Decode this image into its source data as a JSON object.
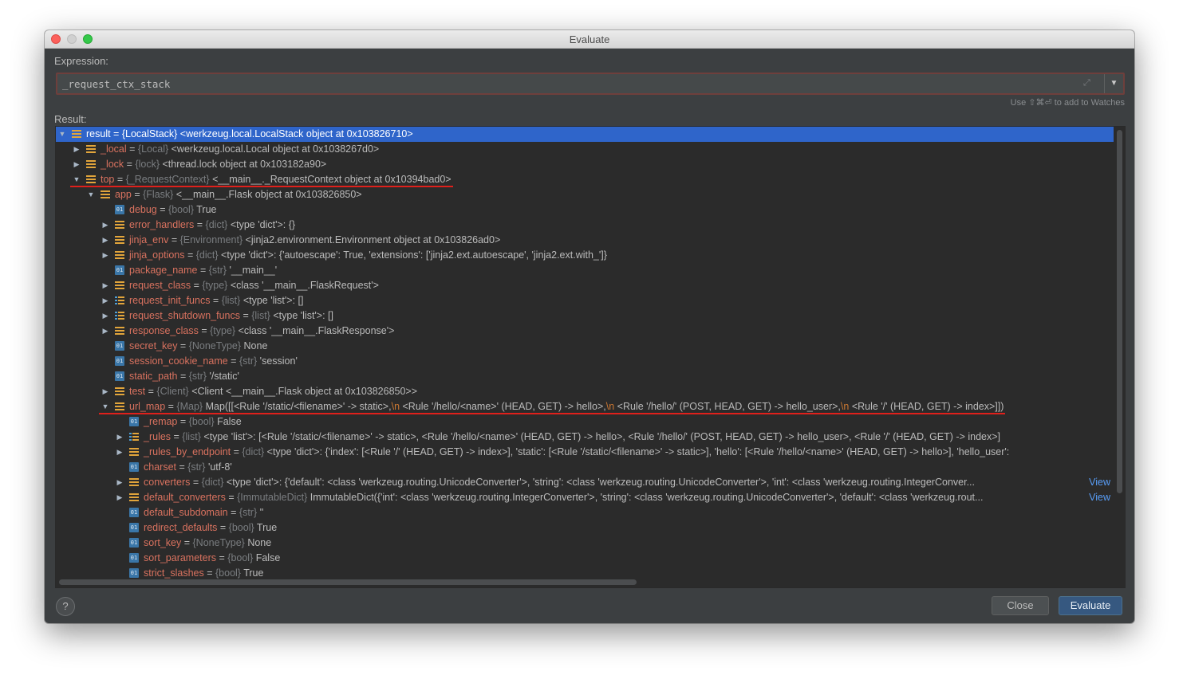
{
  "window": {
    "title": "Evaluate"
  },
  "expression": {
    "label": "Expression:",
    "value": "_request_ctx_stack",
    "hint": "Use ⇧⌘⏎ to add to Watches"
  },
  "result": {
    "label": "Result:"
  },
  "tree_rows": [
    {
      "name": "result",
      "type": "{LocalStack}",
      "value": "<werkzeug.local.LocalStack object at 0x103826710>",
      "toggle": "open",
      "icon": "obj",
      "level": 0,
      "selected": true
    },
    {
      "name": "_local",
      "type": "{Local}",
      "value": "<werkzeug.local.Local object at 0x1038267d0>",
      "toggle": "closed",
      "icon": "obj",
      "level": 1
    },
    {
      "name": "_lock",
      "type": "{lock}",
      "value": "<thread.lock object at 0x103182a90>",
      "toggle": "closed",
      "icon": "obj",
      "level": 1
    },
    {
      "name": "top",
      "type": "{_RequestContext}",
      "value": "<__main__._RequestContext object at 0x10394bad0>",
      "toggle": "open",
      "icon": "obj",
      "level": 1,
      "underline": true
    },
    {
      "name": "app",
      "type": "{Flask}",
      "value": "<__main__.Flask object at 0x103826850>",
      "toggle": "open",
      "icon": "obj",
      "level": 2
    },
    {
      "name": "debug",
      "type": "{bool}",
      "value": "True",
      "toggle": "none",
      "icon": "prim",
      "level": 3
    },
    {
      "name": "error_handlers",
      "type": "{dict}",
      "value": "<type 'dict'>: {}",
      "toggle": "closed",
      "icon": "obj",
      "level": 3
    },
    {
      "name": "jinja_env",
      "type": "{Environment}",
      "value": "<jinja2.environment.Environment object at 0x103826ad0>",
      "toggle": "closed",
      "icon": "obj",
      "level": 3
    },
    {
      "name": "jinja_options",
      "type": "{dict}",
      "value": "<type 'dict'>: {'autoescape': True, 'extensions': ['jinja2.ext.autoescape', 'jinja2.ext.with_']}",
      "toggle": "closed",
      "icon": "obj",
      "level": 3
    },
    {
      "name": "package_name",
      "type": "{str}",
      "value": "'__main__'",
      "toggle": "none",
      "icon": "prim",
      "level": 3
    },
    {
      "name": "request_class",
      "type": "{type}",
      "value": "<class '__main__.FlaskRequest'>",
      "toggle": "closed",
      "icon": "obj",
      "level": 3
    },
    {
      "name": "request_init_funcs",
      "type": "{list}",
      "value": "<type 'list'>: []",
      "toggle": "closed",
      "icon": "list",
      "level": 3
    },
    {
      "name": "request_shutdown_funcs",
      "type": "{list}",
      "value": "<type 'list'>: []",
      "toggle": "closed",
      "icon": "list",
      "level": 3
    },
    {
      "name": "response_class",
      "type": "{type}",
      "value": "<class '__main__.FlaskResponse'>",
      "toggle": "closed",
      "icon": "obj",
      "level": 3
    },
    {
      "name": "secret_key",
      "type": "{NoneType}",
      "value": "None",
      "toggle": "none",
      "icon": "prim",
      "level": 3
    },
    {
      "name": "session_cookie_name",
      "type": "{str}",
      "value": "'session'",
      "toggle": "none",
      "icon": "prim",
      "level": 3
    },
    {
      "name": "static_path",
      "type": "{str}",
      "value": "'/static'",
      "toggle": "none",
      "icon": "prim",
      "level": 3
    },
    {
      "name": "test",
      "type": "{Client}",
      "value": "<Client <__main__.Flask object at 0x103826850>>",
      "toggle": "closed",
      "icon": "obj",
      "level": 3
    },
    {
      "name": "url_map",
      "type": "{Map}",
      "value_parts": [
        "Map([[<Rule '/static/<filename>' -> static>,",
        "\\n",
        " <Rule '/hello/<name>' (HEAD, GET) -> hello>,",
        "\\n",
        " <Rule '/hello/' (POST, HEAD, GET) -> hello_user>,",
        "\\n",
        " <Rule '/' (HEAD, GET) -> index>]])"
      ],
      "toggle": "open",
      "icon": "obj",
      "level": 3,
      "underline": true
    },
    {
      "name": "_remap",
      "type": "{bool}",
      "value": "False",
      "toggle": "none",
      "icon": "prim",
      "level": 4
    },
    {
      "name": "_rules",
      "type": "{list}",
      "value": "<type 'list'>: [<Rule '/static/<filename>' -> static>, <Rule '/hello/<name>' (HEAD, GET) -> hello>, <Rule '/hello/' (POST, HEAD, GET) -> hello_user>, <Rule '/' (HEAD, GET) -> index>]",
      "toggle": "closed",
      "icon": "list",
      "level": 4
    },
    {
      "name": "_rules_by_endpoint",
      "type": "{dict}",
      "value": "<type 'dict'>: {'index': [<Rule '/' (HEAD, GET) -> index>], 'static': [<Rule '/static/<filename>' -> static>], 'hello': [<Rule '/hello/<name>' (HEAD, GET) -> hello>], 'hello_user':",
      "toggle": "closed",
      "icon": "obj",
      "level": 4
    },
    {
      "name": "charset",
      "type": "{str}",
      "value": "'utf-8'",
      "toggle": "none",
      "icon": "prim",
      "level": 4
    },
    {
      "name": "converters",
      "type": "{dict}",
      "value": "<type 'dict'>: {'default': <class 'werkzeug.routing.UnicodeConverter'>, 'string': <class 'werkzeug.routing.UnicodeConverter'>, 'int': <class 'werkzeug.routing.IntegerConver...",
      "toggle": "closed",
      "icon": "obj",
      "level": 4,
      "view": "View"
    },
    {
      "name": "default_converters",
      "type": "{ImmutableDict}",
      "value": "ImmutableDict({'int': <class 'werkzeug.routing.IntegerConverter'>, 'string': <class 'werkzeug.routing.UnicodeConverter'>, 'default': <class 'werkzeug.rout...",
      "toggle": "closed",
      "icon": "obj",
      "level": 4,
      "view": "View"
    },
    {
      "name": "default_subdomain",
      "type": "{str}",
      "value": "''",
      "toggle": "none",
      "icon": "prim",
      "level": 4
    },
    {
      "name": "redirect_defaults",
      "type": "{bool}",
      "value": "True",
      "toggle": "none",
      "icon": "prim",
      "level": 4
    },
    {
      "name": "sort_key",
      "type": "{NoneType}",
      "value": "None",
      "toggle": "none",
      "icon": "prim",
      "level": 4
    },
    {
      "name": "sort_parameters",
      "type": "{bool}",
      "value": "False",
      "toggle": "none",
      "icon": "prim",
      "level": 4
    },
    {
      "name": "strict_slashes",
      "type": "{bool}",
      "value": "True",
      "toggle": "none",
      "icon": "prim",
      "level": 4
    }
  ],
  "icons": {
    "prim_glyph": "01"
  },
  "buttons": {
    "help": "?",
    "close": "Close",
    "evaluate": "Evaluate"
  },
  "colors": {
    "window_bg": "#3c3f41",
    "tree_bg": "#2b2b2b",
    "selection": "#2f65ca",
    "name": "#d9725f",
    "type": "#7a7d80",
    "newline_escape": "#cc7832",
    "link": "#589df6",
    "annotation_underline": "#e0201b"
  }
}
